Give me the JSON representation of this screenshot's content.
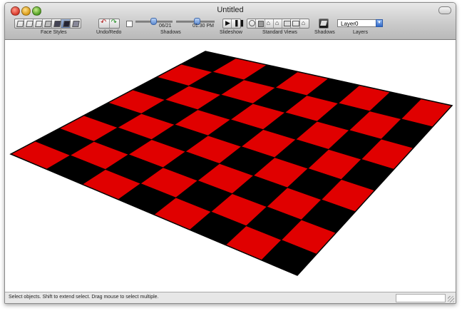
{
  "window": {
    "title": "Untitled"
  },
  "toolbar": {
    "face_styles_label": "Face Styles",
    "undo_redo_label": "Undo/Redo",
    "shadows_slider_label": "Shadows",
    "date_value": "06/21",
    "time_value": "01:30 PM",
    "slideshow_label": "Slideshow",
    "standard_views_label": "Standard Views",
    "shadows_button_label": "Shadows",
    "layers_label": "Layers",
    "layer_value": "Layer0"
  },
  "board": {
    "rows": 8,
    "cols": 8,
    "colors": {
      "red": "#e00000",
      "black": "#000000"
    }
  },
  "status": {
    "text": "Select objects. Shift to extend select. Drag mouse to select multiple."
  }
}
